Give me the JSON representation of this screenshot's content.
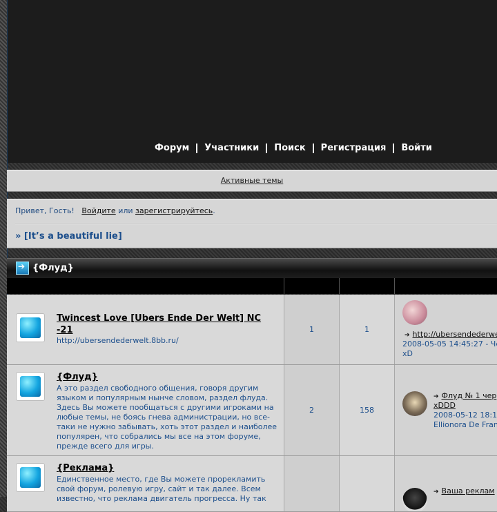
{
  "nav": {
    "items": [
      "Форум",
      "Участники",
      "Поиск",
      "Регистрация",
      "Войти"
    ]
  },
  "active_topics_label": "Активные темы",
  "greeting": {
    "hello": "Привет, Гость!",
    "login": "Войдите",
    "or": "или",
    "register": "зарегистрируйтесь",
    "period": "."
  },
  "breadcrumb": "» [It’s a beautiful lie]",
  "category": {
    "title": "{Флуд}"
  },
  "forums": [
    {
      "title": "Twincest Love [Ubers Ende Der Welt] NC -21",
      "desc": "http://ubersendederwelt.8bb.ru/",
      "topics": "1",
      "posts": "1",
      "last_link": "http://ubersendederwelt",
      "last_date": "2008-05-05 14:45:27 - Че",
      "last_extra": "xD"
    },
    {
      "title": "{Флуд}",
      "desc": "А это раздел свободного общения, говоря другим языком и популярным нынче словом, раздел флуда. Здесь Вы можете пообщаться с другими игроками на любые темы, не боясь гнева администрации, но все-таки не нужно забывать, хоть этот раздел и наиболее популярен, что собрались мы все на этом форуме, прежде всего для игры.",
      "topics": "2",
      "posts": "158",
      "last_link": "Флуд № 1 чер",
      "last_extra": "xDDD",
      "last_date": "2008-05-12 18:1",
      "last_author": "Ellionora De Fran"
    },
    {
      "title": "{Реклама}",
      "desc": "Единственное место, где Вы можете прорекламить свой форум, ролевую игру, сайт и так далее. Всем известно, что реклама двигатель прогресса. Ну так",
      "last_link": "Ваша реклам"
    }
  ],
  "colors": {
    "link_blue": "#1d4f8c",
    "panel": "#d6d6d6",
    "header_bg": "#1c1c1c"
  }
}
